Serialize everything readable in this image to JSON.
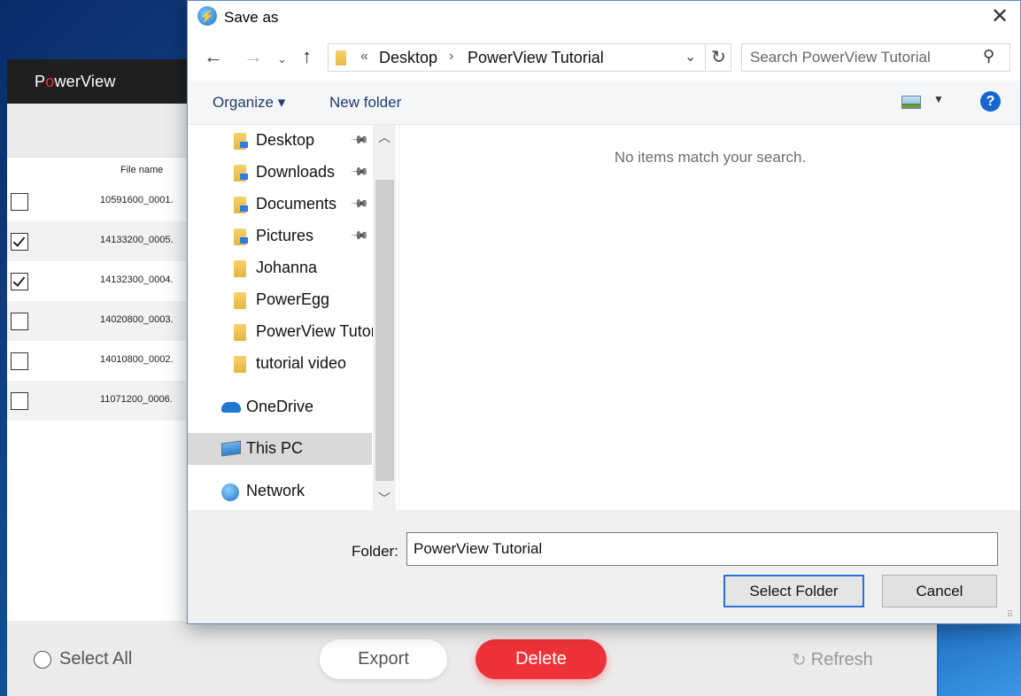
{
  "app": {
    "logo_prefix": "P",
    "logo_o": "o",
    "logo_suffix": "werView",
    "column_header": "File name",
    "files": [
      {
        "name": "10591600_0001.",
        "checked": false
      },
      {
        "name": "14133200_0005.",
        "checked": true
      },
      {
        "name": "14132300_0004.",
        "checked": true
      },
      {
        "name": "14020800_0003.",
        "checked": false
      },
      {
        "name": "14010800_0002.",
        "checked": false
      },
      {
        "name": "11071200_0006.",
        "checked": false
      }
    ],
    "select_all_label": "Select All",
    "export_label": "Export",
    "delete_label": "Delete",
    "refresh_label": "Refresh",
    "delete_color": "#ee3239"
  },
  "dialog": {
    "title": "Save as",
    "close_glyph": "✕",
    "address": {
      "overflow": "«",
      "crumbs": [
        "Desktop",
        "PowerView Tutorial"
      ]
    },
    "search_placeholder": "Search PowerView Tutorial",
    "organize_label": "Organize ▾",
    "new_folder_label": "New folder",
    "help_glyph": "?",
    "nav_items": [
      {
        "label": "Desktop",
        "icon": "desktop-folder-icon",
        "pinned": true
      },
      {
        "label": "Downloads",
        "icon": "downloads-folder-icon",
        "pinned": true
      },
      {
        "label": "Documents",
        "icon": "documents-folder-icon",
        "pinned": true
      },
      {
        "label": "Pictures",
        "icon": "pictures-folder-icon",
        "pinned": true
      },
      {
        "label": "Johanna",
        "icon": "folder-icon",
        "pinned": false
      },
      {
        "label": "PowerEgg",
        "icon": "folder-icon",
        "pinned": false
      },
      {
        "label": "PowerView Tutor",
        "icon": "folder-icon",
        "pinned": false
      },
      {
        "label": "tutorial video",
        "icon": "folder-icon",
        "pinned": false
      }
    ],
    "onedrive_label": "OneDrive",
    "thispc_label": "This PC",
    "network_label": "Network",
    "empty_message": "No items match your search.",
    "folder_label": "Folder:",
    "folder_value": "PowerView Tutorial",
    "select_folder_label": "Select Folder",
    "cancel_label": "Cancel"
  }
}
